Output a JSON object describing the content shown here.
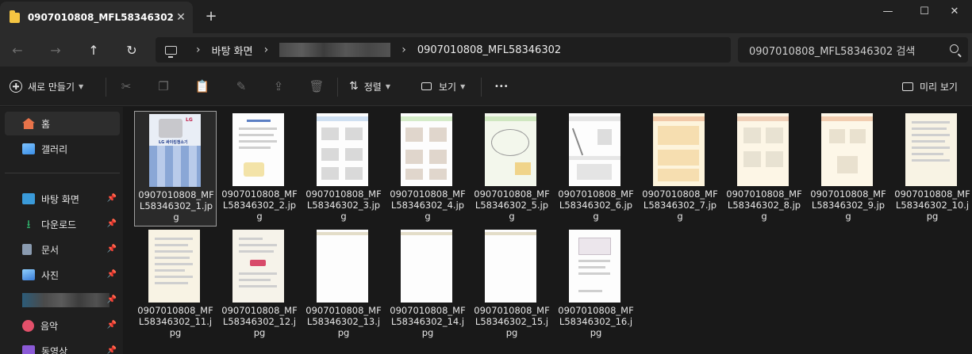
{
  "window": {
    "tab_title": "0907010808_MFL58346302",
    "tab_close": "✕",
    "new_tab": "+",
    "minimize": "—",
    "maximize": "☐",
    "close": "✕"
  },
  "nav": {
    "back": "←",
    "forward": "→",
    "up": "↑",
    "refresh": "↻"
  },
  "address": {
    "sep1": "›",
    "crumb_desktop": "바탕 화면",
    "sep2": "›",
    "sep3": "›",
    "crumb_current": "0907010808_MFL58346302"
  },
  "search": {
    "placeholder": "0907010808_MFL58346302 검색"
  },
  "toolbar": {
    "new_label": "새로 만들기",
    "sort_label": "정렬",
    "view_label": "보기",
    "more_label": "•••",
    "preview_label": "미리 보기"
  },
  "sidebar": {
    "home": "홈",
    "gallery": "갤러리",
    "desktop": "바탕 화면",
    "downloads": "다운로드",
    "documents": "문서",
    "pictures": "사진",
    "music": "음악",
    "videos": "동영상"
  },
  "files": [
    {
      "line1": "0907010808_MF",
      "line2": "L58346302_1.jp",
      "line3": "g"
    },
    {
      "line1": "0907010808_MF",
      "line2": "L58346302_2.jp",
      "line3": "g"
    },
    {
      "line1": "0907010808_MF",
      "line2": "L58346302_3.jp",
      "line3": "g"
    },
    {
      "line1": "0907010808_MF",
      "line2": "L58346302_4.jp",
      "line3": "g"
    },
    {
      "line1": "0907010808_MF",
      "line2": "L58346302_5.jp",
      "line3": "g"
    },
    {
      "line1": "0907010808_MF",
      "line2": "L58346302_6.jp",
      "line3": "g"
    },
    {
      "line1": "0907010808_MF",
      "line2": "L58346302_7.jp",
      "line3": "g"
    },
    {
      "line1": "0907010808_MF",
      "line2": "L58346302_8.jp",
      "line3": "g"
    },
    {
      "line1": "0907010808_MF",
      "line2": "L58346302_9.jp",
      "line3": "g"
    },
    {
      "line1": "0907010808_MF",
      "line2": "L58346302_10.j",
      "line3": "pg"
    },
    {
      "line1": "0907010808_MF",
      "line2": "L58346302_11.j",
      "line3": "pg"
    },
    {
      "line1": "0907010808_MF",
      "line2": "L58346302_12.j",
      "line3": "pg"
    },
    {
      "line1": "0907010808_MF",
      "line2": "L58346302_13.j",
      "line3": "pg"
    },
    {
      "line1": "0907010808_MF",
      "line2": "L58346302_14.j",
      "line3": "pg"
    },
    {
      "line1": "0907010808_MF",
      "line2": "L58346302_15.j",
      "line3": "pg"
    },
    {
      "line1": "0907010808_MF",
      "line2": "L58346302_16.j",
      "line3": "pg"
    }
  ],
  "thumb1": {
    "brand": "LG",
    "product": "LG 싸이킹청소기"
  },
  "colors": {
    "accent_folder": "#f5c542",
    "home_icon": "#e8734a",
    "gallery_icon": "#3a8ee6",
    "desktop_icon": "#3a9ad9",
    "downloads_icon": "#2fb16b",
    "documents_icon": "#8a9bb0",
    "pictures_icon": "#3a7bd5",
    "music_icon": "#e2506a",
    "videos_icon": "#8b5ad6"
  }
}
